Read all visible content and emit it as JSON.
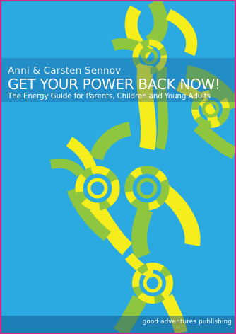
{
  "cover": {
    "author": "Anni & Carsten Sennov",
    "title": "GET YOUR POWER BACK NOW!",
    "subtitle": "The Energy Guide for Parents, Children and Young Adults",
    "publisher": "good adventures publishing"
  },
  "colors": {
    "background": "#2ba9e1",
    "yellow": "#f6ee1c",
    "green": "#8ec63f",
    "border": "#d42a8e"
  },
  "icons": [
    "interlocking-rings-pattern"
  ]
}
